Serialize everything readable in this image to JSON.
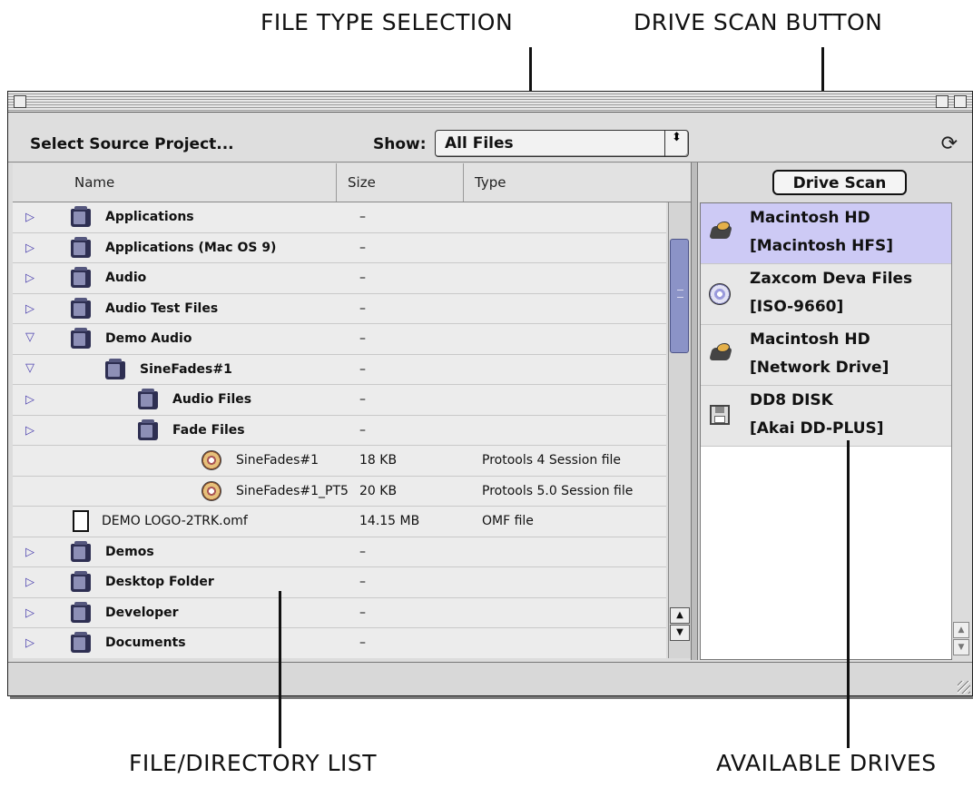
{
  "annotations": {
    "file_type_selection": "FILE TYPE SELECTION",
    "drive_scan_button": "DRIVE SCAN BUTTON",
    "file_directory_list": "FILE/DIRECTORY LIST",
    "available_drives": "AVAILABLE DRIVES"
  },
  "toolbar": {
    "title": "Select Source Project...",
    "show_label": "Show:",
    "show_value": "All Files",
    "popup_arrows": "⬍"
  },
  "columns": {
    "name": "Name",
    "size": "Size",
    "type": "Type"
  },
  "files": [
    {
      "name": "Applications",
      "size": "–",
      "type": "",
      "kind": "folder",
      "expanded": false,
      "level": 0
    },
    {
      "name": "Applications (Mac OS 9)",
      "size": "–",
      "type": "",
      "kind": "folder",
      "expanded": false,
      "level": 0
    },
    {
      "name": "Audio",
      "size": "–",
      "type": "",
      "kind": "folder",
      "expanded": false,
      "level": 0
    },
    {
      "name": "Audio Test Files",
      "size": "–",
      "type": "",
      "kind": "folder",
      "expanded": false,
      "level": 0
    },
    {
      "name": "Demo Audio",
      "size": "–",
      "type": "",
      "kind": "folder",
      "expanded": true,
      "level": 0
    },
    {
      "name": "SineFades#1",
      "size": "–",
      "type": "",
      "kind": "folder",
      "expanded": true,
      "level": 1
    },
    {
      "name": "Audio Files",
      "size": "–",
      "type": "",
      "kind": "folder",
      "expanded": false,
      "level": 2
    },
    {
      "name": "Fade Files",
      "size": "–",
      "type": "",
      "kind": "folder",
      "expanded": false,
      "level": 2
    },
    {
      "name": "SineFades#1",
      "size": "18 KB",
      "type": "Protools 4 Session file",
      "kind": "session",
      "level": 2
    },
    {
      "name": "SineFades#1_PT5",
      "size": "20 KB",
      "type": "Protools 5.0 Session file",
      "kind": "session",
      "level": 2
    },
    {
      "name": "DEMO LOGO-2TRK.omf",
      "size": "14.15 MB",
      "type": "OMF file",
      "kind": "document",
      "level": 0
    },
    {
      "name": "Demos",
      "size": "–",
      "type": "",
      "kind": "folder",
      "expanded": false,
      "level": 0
    },
    {
      "name": "Desktop Folder",
      "size": "–",
      "type": "",
      "kind": "folder",
      "expanded": false,
      "level": 0
    },
    {
      "name": "Developer",
      "size": "–",
      "type": "",
      "kind": "folder",
      "expanded": false,
      "level": 0
    },
    {
      "name": "Documents",
      "size": "–",
      "type": "",
      "kind": "folder",
      "expanded": false,
      "level": 0
    }
  ],
  "drive_scan_label": "Drive Scan",
  "drives": [
    {
      "name": "Macintosh HD",
      "format": "[Macintosh HFS]",
      "icon": "hard-drive-icon",
      "selected": true
    },
    {
      "name": "Zaxcom Deva Files",
      "format": "[ISO-9660]",
      "icon": "cd-icon",
      "selected": false
    },
    {
      "name": "Macintosh HD",
      "format": "[Network Drive]",
      "icon": "hard-drive-icon",
      "selected": false
    },
    {
      "name": "DD8 DISK",
      "format": "[Akai DD-PLUS]",
      "icon": "floppy-disk-icon",
      "selected": false
    }
  ],
  "colors": {
    "selection": "#cdcaf5",
    "scroll_thumb": "#8b93c7",
    "disclosure": "#4a3fae"
  }
}
